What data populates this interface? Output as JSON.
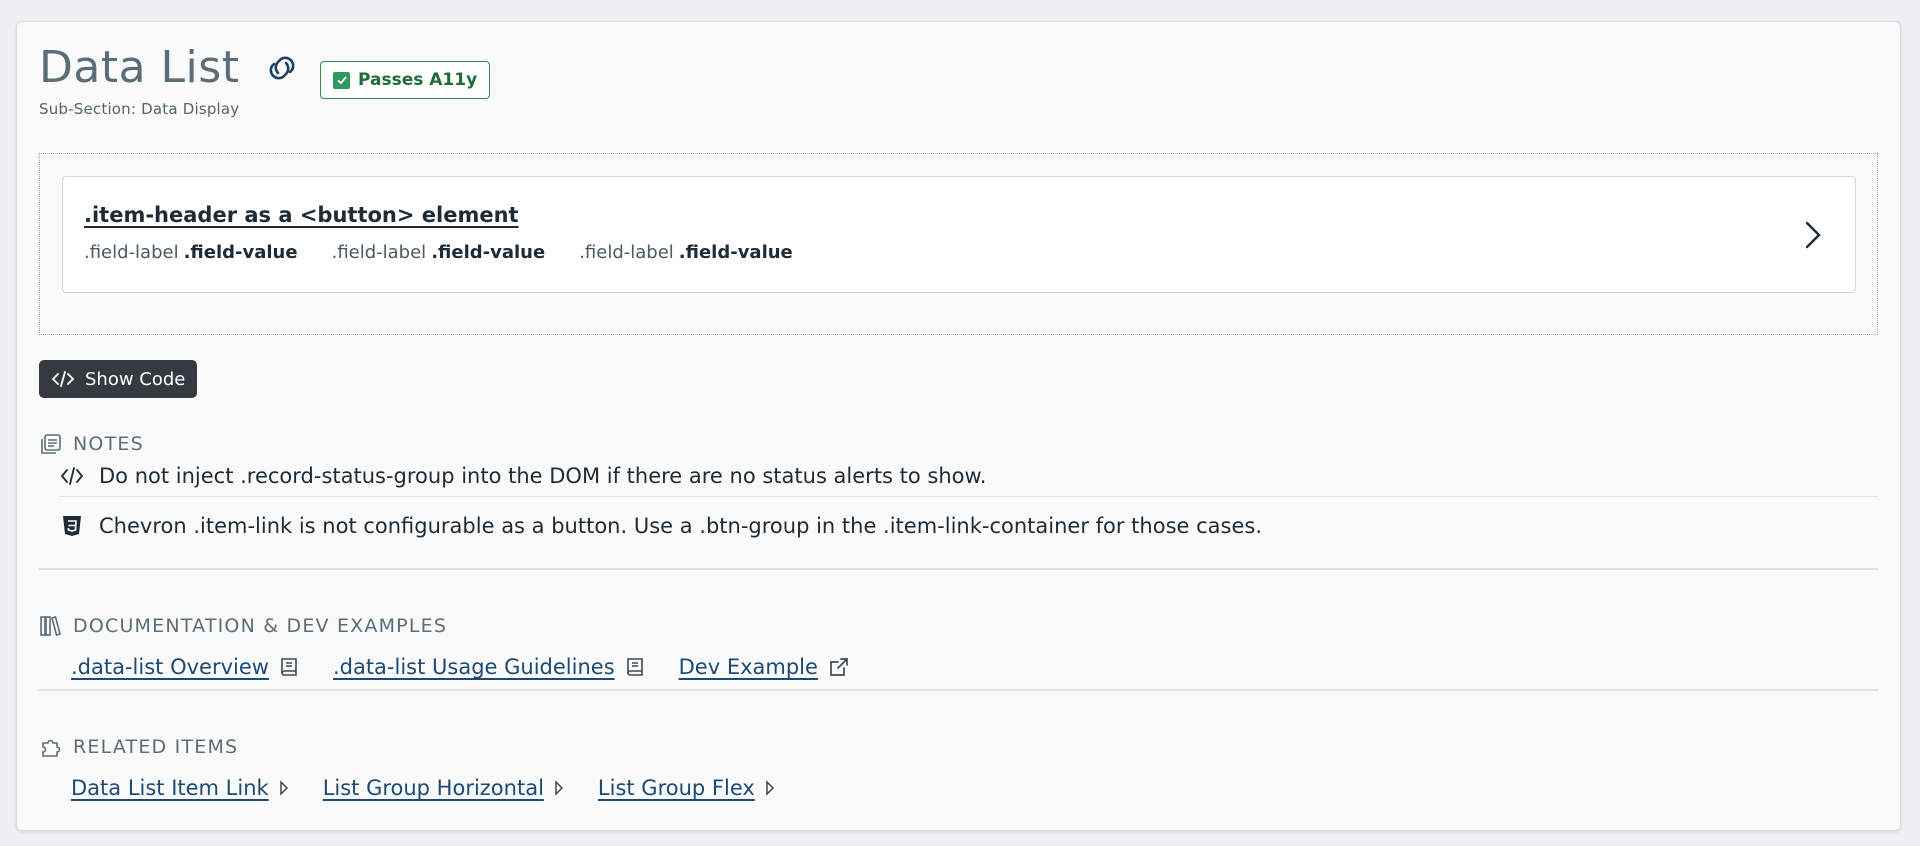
{
  "header": {
    "title": "Data List",
    "subtitle": "Sub-Section: Data Display",
    "a11y_badge": "Passes A11y"
  },
  "demo": {
    "item_header": ".item-header as a <button> element",
    "fields": [
      {
        "label": ".field-label",
        "value": ".field-value"
      },
      {
        "label": ".field-label",
        "value": ".field-value"
      },
      {
        "label": ".field-label",
        "value": ".field-value"
      }
    ]
  },
  "show_code_label": "Show Code",
  "notes": {
    "heading": "NOTES",
    "items": [
      {
        "icon": "code-icon",
        "text": "Do not inject .record-status-group into the DOM if there are no status alerts to show."
      },
      {
        "icon": "css3-icon",
        "text": "Chevron .item-link is not configurable as a button. Use a .btn-group in the .item-link-container for those cases."
      }
    ]
  },
  "documentation": {
    "heading": "DOCUMENTATION & DEV EXAMPLES",
    "links": [
      {
        "label": ".data-list Overview",
        "icon": "book-icon"
      },
      {
        "label": ".data-list Usage Guidelines",
        "icon": "book-icon"
      },
      {
        "label": "Dev Example",
        "icon": "external-link-icon"
      }
    ]
  },
  "related": {
    "heading": "RELATED ITEMS",
    "links": [
      {
        "label": "Data List Item Link",
        "icon": "caret-right-icon"
      },
      {
        "label": "List Group Horizontal",
        "icon": "caret-right-icon"
      },
      {
        "label": "List Group Flex",
        "icon": "caret-right-icon"
      }
    ]
  },
  "colors": {
    "title": "#5b6d78",
    "badge_green": "#2e8b57",
    "link": "#1a4b78",
    "button_dark": "#343a40"
  }
}
